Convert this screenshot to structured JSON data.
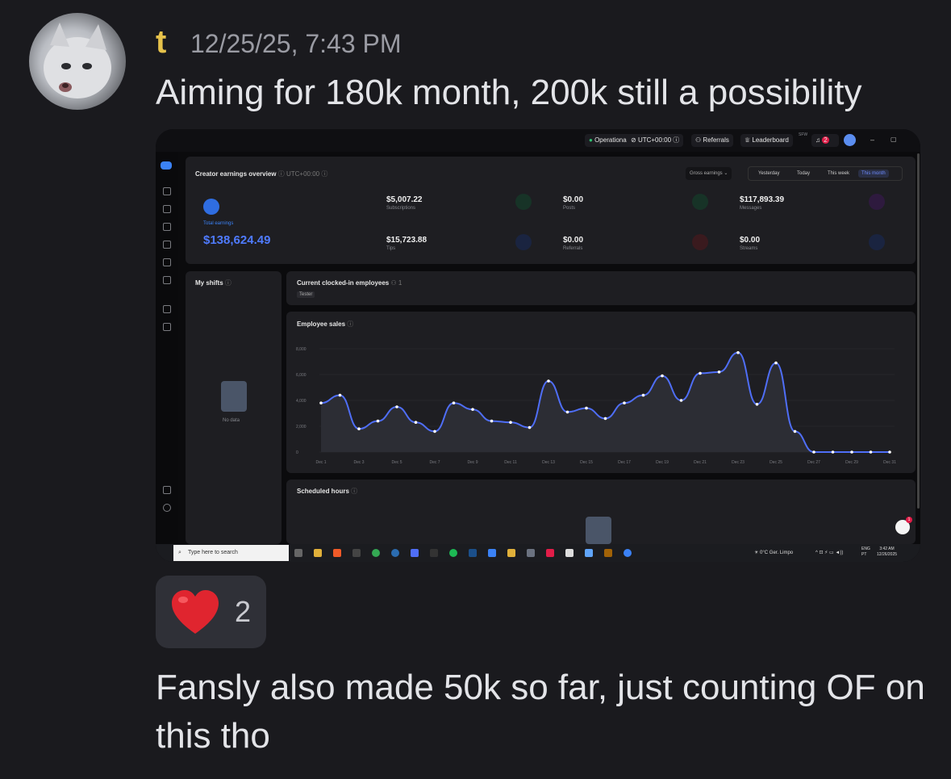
{
  "message": {
    "username": "t",
    "timestamp": "12/25/25, 7:43 PM",
    "text": "Aiming for 180k month, 200k still a possibility",
    "reaction": {
      "emoji": "heart",
      "count": "2"
    },
    "followup_text": "Fansly also made 50k so far, just counting OF on this tho"
  },
  "dashboard": {
    "topbar": {
      "status": "Operational",
      "timezone": "UTC+00:00",
      "referrals": "Referrals",
      "leaderboard": "Leaderboard",
      "sfw": "SFW",
      "notif_count": "2"
    },
    "overview_title": "Creator earnings overview",
    "overview_tz": "UTC+00:00",
    "filter_select": "Gross earnings",
    "period_tabs": [
      "Yesterday",
      "Today",
      "This week",
      "This month"
    ],
    "active_period": "This month",
    "total_label": "Total earnings",
    "total_value": "$138,624.49",
    "stats": [
      {
        "value": "$5,007.22",
        "label": "Subscriptions",
        "color": "#2fbf71"
      },
      {
        "value": "$0.00",
        "label": "Posts",
        "color": "#2fbf71"
      },
      {
        "value": "$117,893.39",
        "label": "Messages",
        "color": "#a855f7"
      },
      {
        "value": "$15,723.88",
        "label": "Tips",
        "color": "#3b82f6"
      },
      {
        "value": "$0.00",
        "label": "Referrals",
        "color": "#ef4444"
      },
      {
        "value": "$0.00",
        "label": "Streams",
        "color": "#3b82f6"
      }
    ],
    "my_shifts_title": "My shifts",
    "no_data": "No data",
    "clocked_in_title": "Current clocked-in employees",
    "clocked_in_count": "1",
    "clocked_in_tag": "Tester",
    "sales_title": "Employee sales",
    "scheduled_title": "Scheduled hours",
    "taskbar_search": "Type here to search",
    "weather": "0°C  Ger. Limpo",
    "lang": "ENG",
    "lang2": "PT",
    "clock_time": "3:42 AM",
    "clock_date": "12/26/2025",
    "chat_badge": "1"
  },
  "chart_data": {
    "type": "area",
    "title": "Employee sales",
    "x": [
      "Dec 1",
      "Dec 2",
      "Dec 3",
      "Dec 4",
      "Dec 5",
      "Dec 6",
      "Dec 7",
      "Dec 8",
      "Dec 9",
      "Dec 10",
      "Dec 11",
      "Dec 12",
      "Dec 13",
      "Dec 14",
      "Dec 15",
      "Dec 16",
      "Dec 17",
      "Dec 18",
      "Dec 19",
      "Dec 20",
      "Dec 21",
      "Dec 22",
      "Dec 23",
      "Dec 24",
      "Dec 25",
      "Dec 26",
      "Dec 27",
      "Dec 28",
      "Dec 29",
      "Dec 30",
      "Dec 31"
    ],
    "x_tick_labels": [
      "Dec 1",
      "Dec 3",
      "Dec 5",
      "Dec 7",
      "Dec 9",
      "Dec 11",
      "Dec 13",
      "Dec 15",
      "Dec 17",
      "Dec 19",
      "Dec 21",
      "Dec 23",
      "Dec 25",
      "Dec 27",
      "Dec 29",
      "Dec 31"
    ],
    "values": [
      3800,
      4400,
      1800,
      2400,
      3500,
      2300,
      1600,
      3800,
      3300,
      2400,
      2300,
      1900,
      5500,
      3100,
      3400,
      2600,
      3800,
      4400,
      5900,
      4000,
      6100,
      6200,
      7700,
      3700,
      6900,
      1600,
      0,
      0,
      0,
      0,
      0
    ],
    "y_ticks": [
      "0",
      "2,000",
      "4,000",
      "6,000",
      "8,000"
    ],
    "ylim": [
      0,
      8000
    ],
    "line_color": "#4f6ef7",
    "grid": true
  }
}
